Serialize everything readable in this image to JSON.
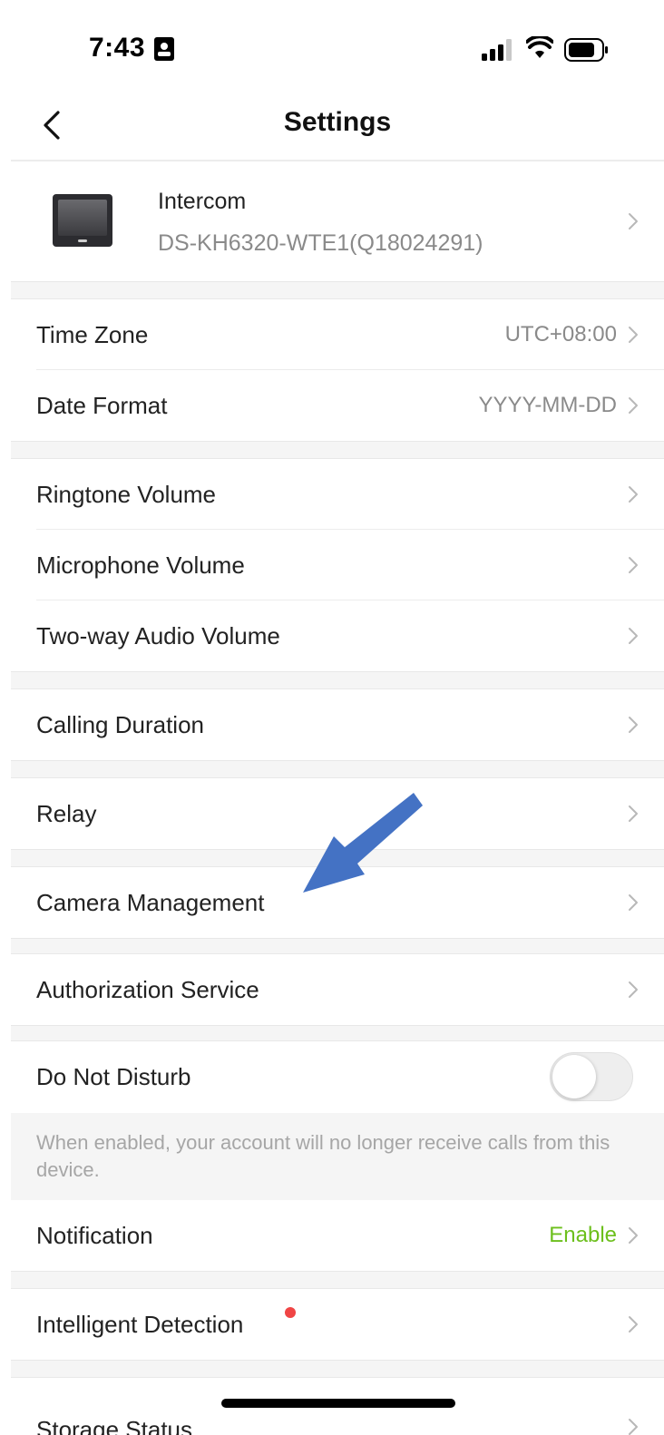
{
  "status_bar": {
    "time": "7:43"
  },
  "header": {
    "title": "Settings"
  },
  "device": {
    "name": "Intercom",
    "model": "DS-KH6320-WTE1(Q18024291)"
  },
  "settings": {
    "time_zone": {
      "label": "Time Zone",
      "value": "UTC+08:00"
    },
    "date_format": {
      "label": "Date Format",
      "value": "YYYY-MM-DD"
    },
    "ringtone_volume": {
      "label": "Ringtone Volume"
    },
    "microphone_volume": {
      "label": "Microphone Volume"
    },
    "two_way_audio_volume": {
      "label": "Two-way Audio Volume"
    },
    "calling_duration": {
      "label": "Calling Duration"
    },
    "relay": {
      "label": "Relay"
    },
    "camera_management": {
      "label": "Camera Management"
    },
    "authorization_service": {
      "label": "Authorization Service"
    },
    "do_not_disturb": {
      "label": "Do Not Disturb",
      "enabled": false,
      "note": "When enabled, your account will no longer receive calls from this device."
    },
    "notification": {
      "label": "Notification",
      "value": "Enable"
    },
    "intelligent_detection": {
      "label": "Intelligent Detection"
    },
    "storage_status": {
      "label": "Storage Status"
    }
  },
  "colors": {
    "accent_green": "#6cbf1c",
    "badge_red": "#f04545",
    "annotation_arrow": "#4472c4"
  },
  "icons": [
    "contact-card-icon",
    "signal-icon",
    "wifi-icon",
    "battery-icon",
    "chevron-left-icon",
    "chevron-right-icon",
    "device-monitor-icon",
    "blue-arrow-annotation"
  ]
}
